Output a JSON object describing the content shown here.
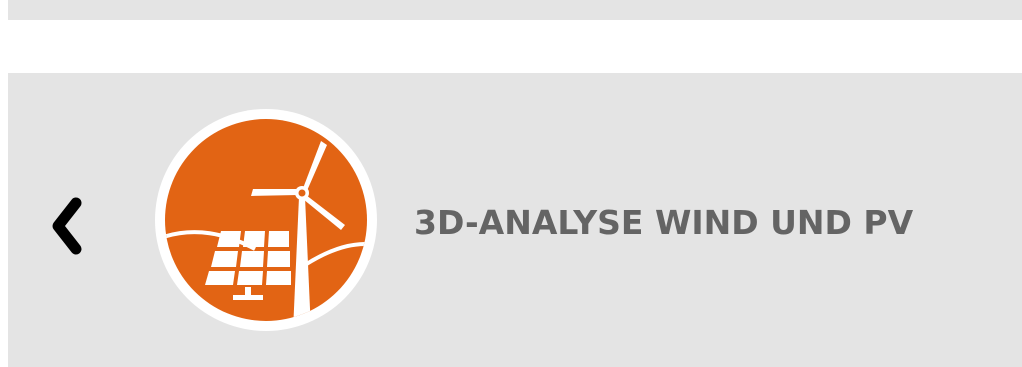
{
  "card": {
    "title": "3D-ANALYSE WIND UND PV",
    "back_icon": "chevron-left-icon",
    "feature_icon": "wind-turbine-solar-panel-icon"
  },
  "colors": {
    "card_background": "#e4e4e4",
    "icon_circle": "#e26414",
    "icon_border": "#ffffff",
    "title_text": "#646464",
    "back_arrow": "#000000"
  }
}
